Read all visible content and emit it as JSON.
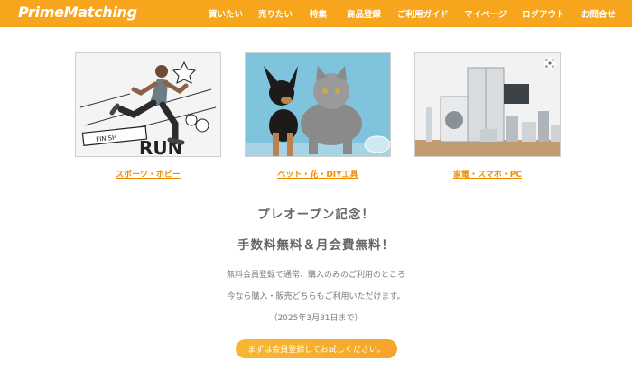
{
  "header": {
    "logo": "PrimeMatching",
    "nav": [
      {
        "label": "買いたい"
      },
      {
        "label": "売りたい"
      },
      {
        "label": "特集"
      },
      {
        "label": "商品登録"
      },
      {
        "label": "ご利用ガイド"
      },
      {
        "label": "マイページ"
      },
      {
        "label": "ログアウト"
      },
      {
        "label": "お問合せ"
      }
    ]
  },
  "categories": [
    {
      "label": "スポーツ・ホビー",
      "icon": "sports-runner-image"
    },
    {
      "label": "ペット・花・DIY工具",
      "icon": "pets-image"
    },
    {
      "label": "家電・スマホ・PC",
      "icon": "appliances-image"
    }
  ],
  "promo": {
    "title1": "プレオープン記念！",
    "title2": "手数料無料＆月会費無料！",
    "line1": "無料会員登録で通常、購入のみのご利用のところ",
    "line2": "今なら購入・販売どちらもご利用いただけます。",
    "line3": "（2025年3月31日まで）"
  },
  "cta": {
    "label": "まずは会員登録してお試しください。"
  },
  "colors": {
    "accent": "#f7a51c",
    "link": "#f08c00"
  }
}
